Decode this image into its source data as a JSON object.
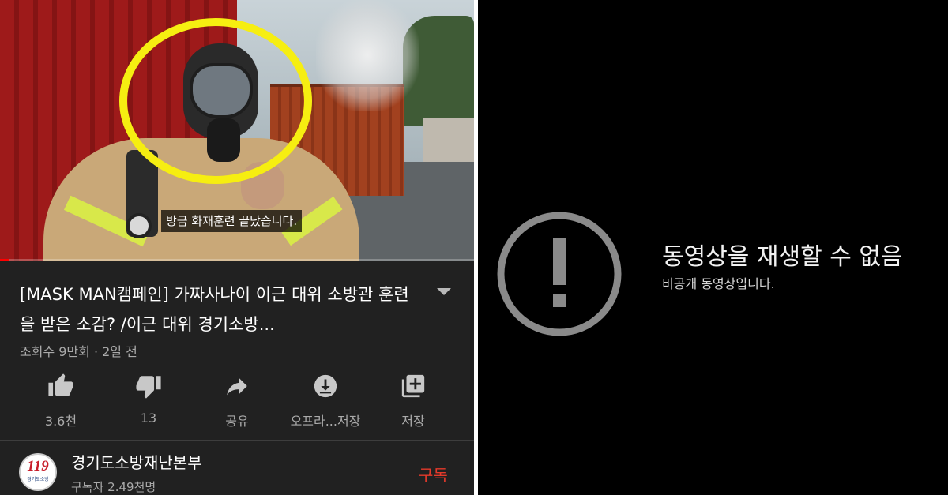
{
  "video": {
    "subtitle": "방금 화재훈련 끝났습니다.",
    "progress_fraction": 0.02,
    "title": "[MASK MAN캠페인] 가짜사나이 이근 대위 소방관 훈련을 받은 소감? /이근 대위 경기소방...",
    "meta": "조회수 9만회 · 2일 전"
  },
  "actions": [
    {
      "label": "3.6천",
      "icon": "thumbs-up-icon"
    },
    {
      "label": "13",
      "icon": "thumbs-down-icon"
    },
    {
      "label": "공유",
      "icon": "share-icon"
    },
    {
      "label": "오프라...저장",
      "icon": "download-icon"
    },
    {
      "label": "저장",
      "icon": "playlist-add-icon"
    }
  ],
  "channel": {
    "name": "경기도소방재난본부",
    "subscribers": "구독자 2.49천명",
    "subscribe_label": "구독",
    "avatar_logo_number": "119",
    "avatar_logo_caption": "경기도소방"
  },
  "unavailable": {
    "title": "동영상을 재생할 수 없음",
    "subtitle": "비공개 동영상입니다.",
    "icon": "alert-circle-icon"
  },
  "colors": {
    "app_background": "#212121",
    "subscribe_red": "#e53a2b",
    "progress_red": "#ff0000",
    "highlight_yellow": "#f6ee11",
    "error_background": "#000000"
  }
}
